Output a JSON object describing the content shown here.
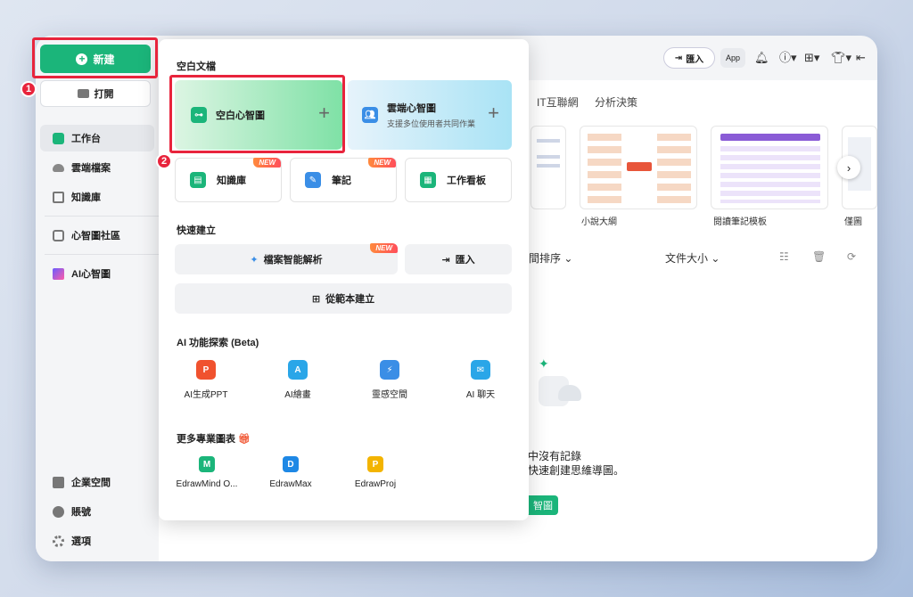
{
  "sidebar": {
    "new_label": "新建",
    "open_label": "打開",
    "items": [
      {
        "label": "工作台",
        "icon": "workspace-icon"
      },
      {
        "label": "雲端檔案",
        "icon": "cloud-icon"
      },
      {
        "label": "知識庫",
        "icon": "knowledge-icon"
      },
      {
        "label": "心智圖社區",
        "icon": "community-icon"
      },
      {
        "label": "AI心智圖",
        "icon": "ai-mindmap-icon"
      }
    ],
    "bottom_items": [
      {
        "label": "企業空間",
        "icon": "enterprise-icon"
      },
      {
        "label": "賬號",
        "icon": "account-icon"
      },
      {
        "label": "選項",
        "icon": "settings-icon"
      }
    ]
  },
  "topbar": {
    "import_label": "匯入",
    "app_label": "App"
  },
  "main": {
    "tabs": [
      "IT互聯網",
      "分析決策"
    ],
    "templates": [
      "小說大綱",
      "閱讀筆記模板",
      "僅圖"
    ],
    "sort_time": "間排序",
    "sort_size": "文件大小",
    "empty_line1": "中沒有記錄",
    "empty_line2": "快速創建思維導圖。",
    "empty_button": "智圖"
  },
  "panel": {
    "blank_title": "空白文檔",
    "blank_mindmap": "空白心智圖",
    "cloud_mindmap": "雲端心智圖",
    "cloud_sub": "支援多位使用者共同作業",
    "cards": [
      {
        "label": "知識庫",
        "new": true
      },
      {
        "label": "筆記",
        "new": true
      },
      {
        "label": "工作看板",
        "new": false
      }
    ],
    "new_badge": "NEW",
    "quick_title": "快速建立",
    "smart_parse": "檔案智能解析",
    "import_label": "匯入",
    "from_template": "從範本建立",
    "ai_title": "AI 功能探索 (Beta)",
    "ai_items": [
      "AI生成PPT",
      "AI繪畫",
      "靈感空間",
      "AI 聊天"
    ],
    "more_title": "更多專業圖表",
    "pro_items": [
      "EdrawMind O...",
      "EdrawMax",
      "EdrawProj"
    ]
  },
  "annotations": {
    "step1": "1",
    "step2": "2",
    "highlight_color": "#e8243c"
  },
  "colors": {
    "brand_green": "#1bb57a"
  }
}
